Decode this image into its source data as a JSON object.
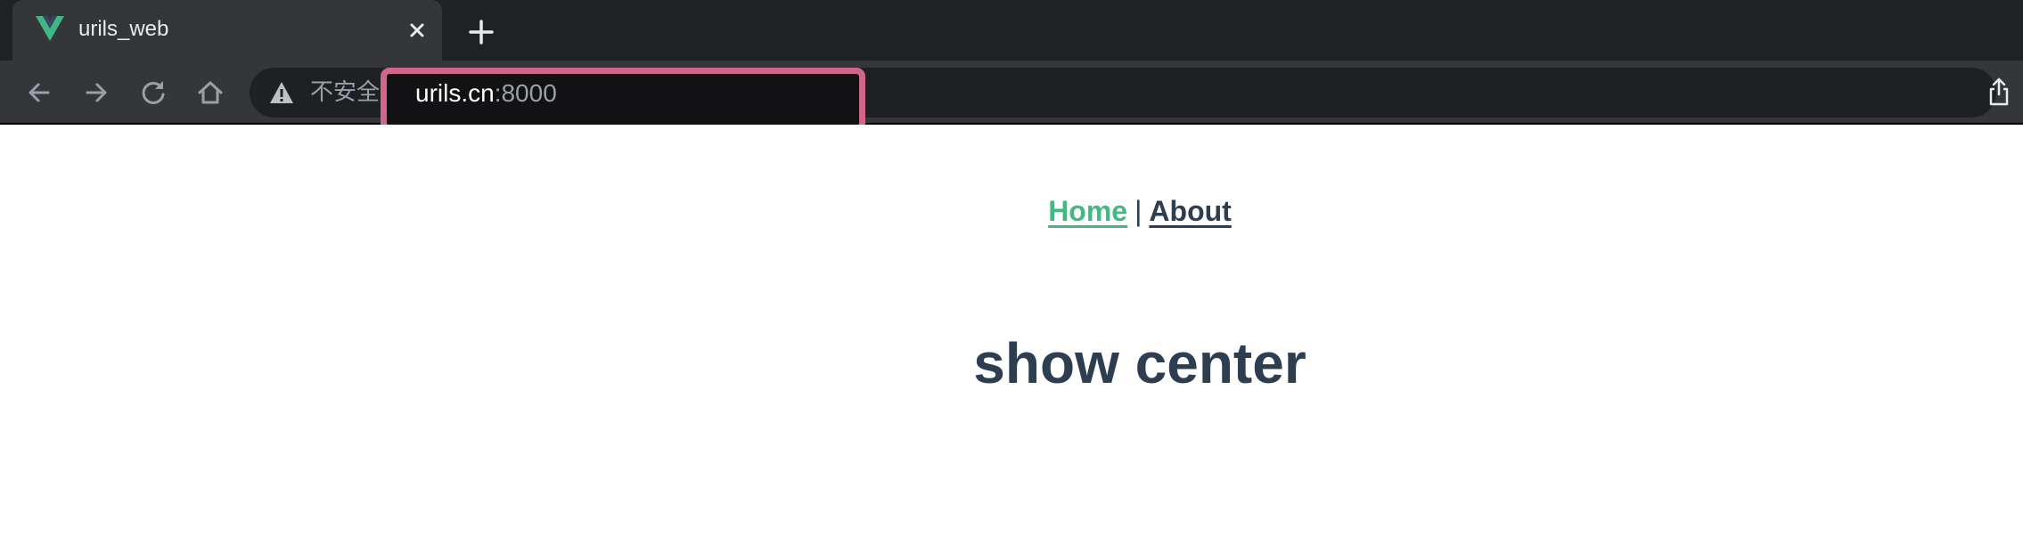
{
  "browser": {
    "tab": {
      "title": "urils_web",
      "favicon": "vue-logo-icon"
    },
    "toolbar": {
      "back": "arrow-left-icon",
      "forward": "arrow-right-icon",
      "reload": "reload-icon",
      "home": "home-icon",
      "share": "share-icon"
    },
    "omnibox": {
      "security_label": "不安全",
      "url_host": "urils.cn",
      "url_port": ":8000"
    }
  },
  "page": {
    "nav": {
      "home_label": "Home",
      "separator": "|",
      "about_label": "About"
    },
    "heading": "show center"
  },
  "colors": {
    "accent": "#42b983",
    "text": "#2c3e50",
    "highlight": "#d1668a",
    "chrome_dark": "#202124",
    "chrome_toolbar": "#35363a"
  }
}
